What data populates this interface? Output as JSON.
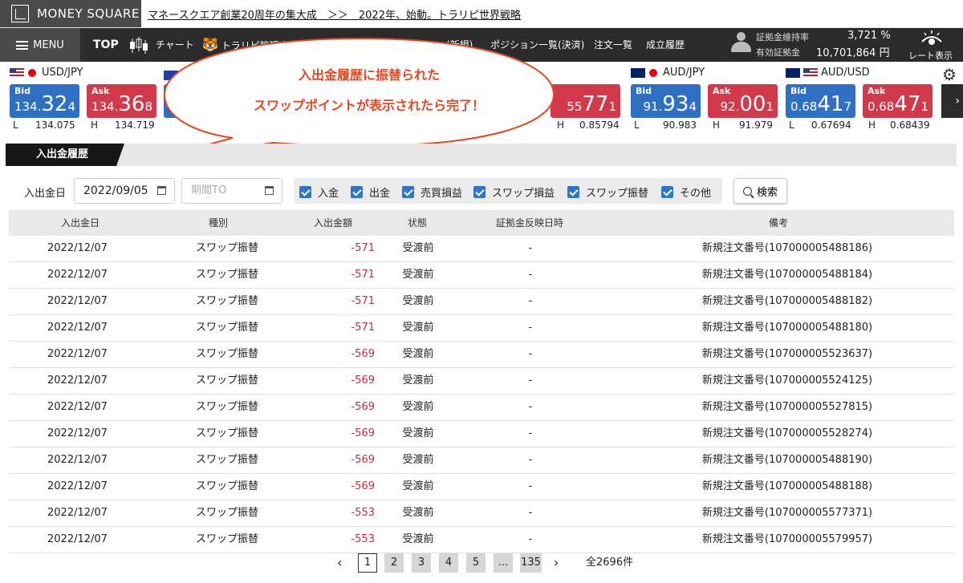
{
  "header": {
    "logo_text": "MONEY SQUARE",
    "news_link": "マネースクエア創業20周年の集大成　＞＞　2022年、始動。トラリピ世界戦略"
  },
  "nav": {
    "menu_label": "MENU",
    "top_label": "TOP",
    "chart_label": "チャート",
    "trarip_label": "トラリピ管理表",
    "new_order_label": "(新規)",
    "positions_label": "ポジション一覧(決済)",
    "orders_label": "注文一覧",
    "executions_label": "成立履歴",
    "margin_ratio_label": "証拠金維持率",
    "margin_ratio_value": "3,721 %",
    "effective_margin_label": "有効証拠金",
    "effective_margin_value": "10,701,864 円",
    "rate_display_label": "レート表示"
  },
  "rates": [
    {
      "pair": "USD/JPY",
      "bid_main": "134.",
      "bid_big": "32",
      "bid_small": "4",
      "ask_main": "134.",
      "ask_big": "36",
      "ask_small": "8",
      "low": "134.075",
      "high": "134.719"
    },
    {
      "ask_big": "77",
      "ask_small": "1",
      "ask_main": "55",
      "high": "0.85794"
    },
    {
      "pair": "AUD/JPY",
      "bid_main": "91.",
      "bid_big": "93",
      "bid_small": "4",
      "ask_main": "92.",
      "ask_big": "00",
      "ask_small": "1",
      "low": "90.983",
      "high": "91.979"
    },
    {
      "pair": "AUD/USD",
      "bid_main": "0.68",
      "bid_big": "41",
      "bid_small": "7",
      "ask_main": "0.68",
      "ask_big": "47",
      "ask_small": "1",
      "low": "0.67694",
      "high": "0.68439"
    }
  ],
  "labels": {
    "bid": "Bid",
    "ask": "Ask",
    "low": "L",
    "high": "H"
  },
  "callout": {
    "line1": "入出金履歴に振替られた",
    "line2": "スワップポイントが表示されたら完了！"
  },
  "tab": {
    "label": "入出金履歴"
  },
  "filters": {
    "date_label": "入出金日",
    "date_from": "2022/09/05",
    "date_to_placeholder": "期間TO",
    "checkboxes": [
      "入金",
      "出金",
      "売買損益",
      "スワップ損益",
      "スワップ振替",
      "その他"
    ],
    "search_label": "検索"
  },
  "table": {
    "headers": [
      "入出金日",
      "種別",
      "入出金額",
      "状態",
      "証拠金反映日時",
      "備考"
    ],
    "rows": [
      {
        "date": "2022/12/07",
        "type": "スワップ振替",
        "amount": "-571",
        "status": "受渡前",
        "reflected": "-",
        "note": "新規注文番号(107000005488186)"
      },
      {
        "date": "2022/12/07",
        "type": "スワップ振替",
        "amount": "-571",
        "status": "受渡前",
        "reflected": "-",
        "note": "新規注文番号(107000005488184)"
      },
      {
        "date": "2022/12/07",
        "type": "スワップ振替",
        "amount": "-571",
        "status": "受渡前",
        "reflected": "-",
        "note": "新規注文番号(107000005488182)"
      },
      {
        "date": "2022/12/07",
        "type": "スワップ振替",
        "amount": "-571",
        "status": "受渡前",
        "reflected": "-",
        "note": "新規注文番号(107000005488180)"
      },
      {
        "date": "2022/12/07",
        "type": "スワップ振替",
        "amount": "-569",
        "status": "受渡前",
        "reflected": "-",
        "note": "新規注文番号(107000005523637)"
      },
      {
        "date": "2022/12/07",
        "type": "スワップ振替",
        "amount": "-569",
        "status": "受渡前",
        "reflected": "-",
        "note": "新規注文番号(107000005524125)"
      },
      {
        "date": "2022/12/07",
        "type": "スワップ振替",
        "amount": "-569",
        "status": "受渡前",
        "reflected": "-",
        "note": "新規注文番号(107000005527815)"
      },
      {
        "date": "2022/12/07",
        "type": "スワップ振替",
        "amount": "-569",
        "status": "受渡前",
        "reflected": "-",
        "note": "新規注文番号(107000005528274)"
      },
      {
        "date": "2022/12/07",
        "type": "スワップ振替",
        "amount": "-569",
        "status": "受渡前",
        "reflected": "-",
        "note": "新規注文番号(107000005488190)"
      },
      {
        "date": "2022/12/07",
        "type": "スワップ振替",
        "amount": "-569",
        "status": "受渡前",
        "reflected": "-",
        "note": "新規注文番号(107000005488188)"
      },
      {
        "date": "2022/12/07",
        "type": "スワップ振替",
        "amount": "-553",
        "status": "受渡前",
        "reflected": "-",
        "note": "新規注文番号(107000005577371)"
      },
      {
        "date": "2022/12/07",
        "type": "スワップ振替",
        "amount": "-553",
        "status": "受渡前",
        "reflected": "-",
        "note": "新規注文番号(107000005579957)"
      }
    ]
  },
  "pagination": {
    "pages": [
      "1",
      "2",
      "3",
      "4",
      "5",
      "…",
      "135"
    ],
    "current": "1",
    "prev": "‹",
    "next": "›",
    "total": "全2696件"
  },
  "colors": {
    "bid": "#2f70c5",
    "ask": "#d23a4b",
    "negative_amount": "#b7323a",
    "callout_text": "#e8451e"
  }
}
